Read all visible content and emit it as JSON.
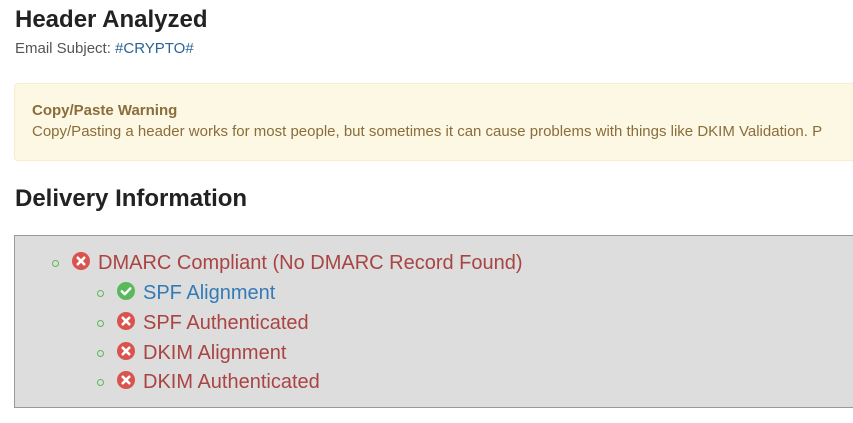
{
  "header": {
    "title": "Header Analyzed",
    "subject_label": "Email Subject:",
    "subject_value": "#CRYPTO#"
  },
  "warning": {
    "title": "Copy/Paste Warning",
    "text": "Copy/Pasting a header works for most people, but sometimes it can cause problems with things like DKIM Validation. P"
  },
  "delivery": {
    "title": "Delivery Information",
    "items": [
      {
        "label": "DMARC Compliant (No DMARC Record Found)",
        "status": "fail",
        "icon": "times-circle-icon"
      },
      {
        "label": "SPF Alignment",
        "status": "pass",
        "icon": "check-circle-icon"
      },
      {
        "label": "SPF Authenticated",
        "status": "fail",
        "icon": "times-circle-icon"
      },
      {
        "label": "DKIM Alignment",
        "status": "fail",
        "icon": "times-circle-icon"
      },
      {
        "label": "DKIM Authenticated",
        "status": "fail",
        "icon": "times-circle-icon"
      }
    ]
  },
  "colors": {
    "fail": "#d9534f",
    "pass": "#5cb85c",
    "fail_text": "#a94442",
    "pass_text": "#337ab7",
    "warning_bg": "#fcf8e3"
  }
}
